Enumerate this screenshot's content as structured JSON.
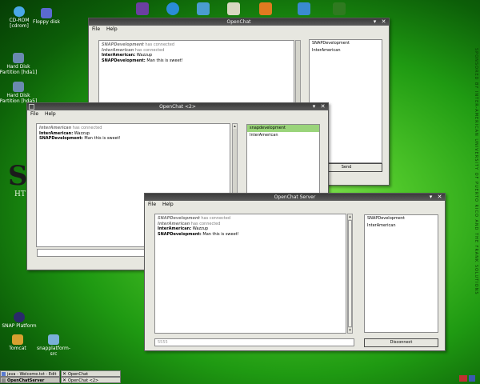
{
  "desktop": {
    "icons": [
      {
        "label": "CD-ROM\n[cdrom]"
      },
      {
        "label": "Floppy disk"
      },
      {
        "label": "Hard Disk\nPartition [hda1]"
      },
      {
        "label": "Hard Disk\nPartition [hda5]"
      },
      {
        "label": "SNAP Platform"
      },
      {
        "label": "Tomcat"
      },
      {
        "label": "snapplatform-src"
      }
    ],
    "brand_letter": "S",
    "brand_sub": "HT",
    "side_text": "SPONSORED BY INTER-AMERICAN UNIVERSITY OF PUERTO RICO AND THE FRANK SOLUTIONS"
  },
  "windows": {
    "back": {
      "title": "OpenChat",
      "menu": [
        "File",
        "Help"
      ],
      "messages": [
        {
          "type": "sys",
          "user": "SNAPDevelopment",
          "text": " has connected"
        },
        {
          "type": "sys",
          "user": "InterAmerican",
          "text": " has connected"
        },
        {
          "type": "msg",
          "user": "InterAmerican:",
          "text": " Wazzup"
        },
        {
          "type": "msg",
          "user": "SNAPDevelopment:",
          "text": " Man this is sweet!"
        }
      ],
      "users": [
        "SNAPDevelopment",
        "InterAmerican"
      ],
      "send_label": "Send"
    },
    "middle": {
      "title": "OpenChat <2>",
      "menu": [
        "File",
        "Help"
      ],
      "messages": [
        {
          "type": "sys",
          "user": "InterAmerican",
          "text": " has connected"
        },
        {
          "type": "msg",
          "user": "InterAmerican:",
          "text": " Wazzup"
        },
        {
          "type": "msg",
          "user": "SNAPDevelopment:",
          "text": " Man this is sweet!"
        }
      ],
      "users": [
        "snapdevelopment",
        "InterAmerican"
      ]
    },
    "server": {
      "title": "OpenChat Server",
      "menu": [
        "File",
        "Help"
      ],
      "messages": [
        {
          "type": "sys",
          "user": "SNAPDevelopment",
          "text": " has connected"
        },
        {
          "type": "sys",
          "user": "InterAmerican",
          "text": " has connected"
        },
        {
          "type": "msg",
          "user": "InterAmerican:",
          "text": " Wazzup"
        },
        {
          "type": "msg",
          "user": "SNAPDevelopment:",
          "text": " Man this is sweet!"
        }
      ],
      "users": [
        "SNAPDevelopment",
        "InterAmerican"
      ],
      "port_value": "5555",
      "disconnect_label": "Disconnect"
    }
  },
  "taskbar": {
    "tasks": [
      "java - Welcome.txt - Edit",
      "OpenChat",
      "OpenChatServer",
      "OpenChat <2>"
    ]
  },
  "colors": {
    "selected_user": "#9ad47a",
    "desktop_green": "#4fc72a"
  }
}
